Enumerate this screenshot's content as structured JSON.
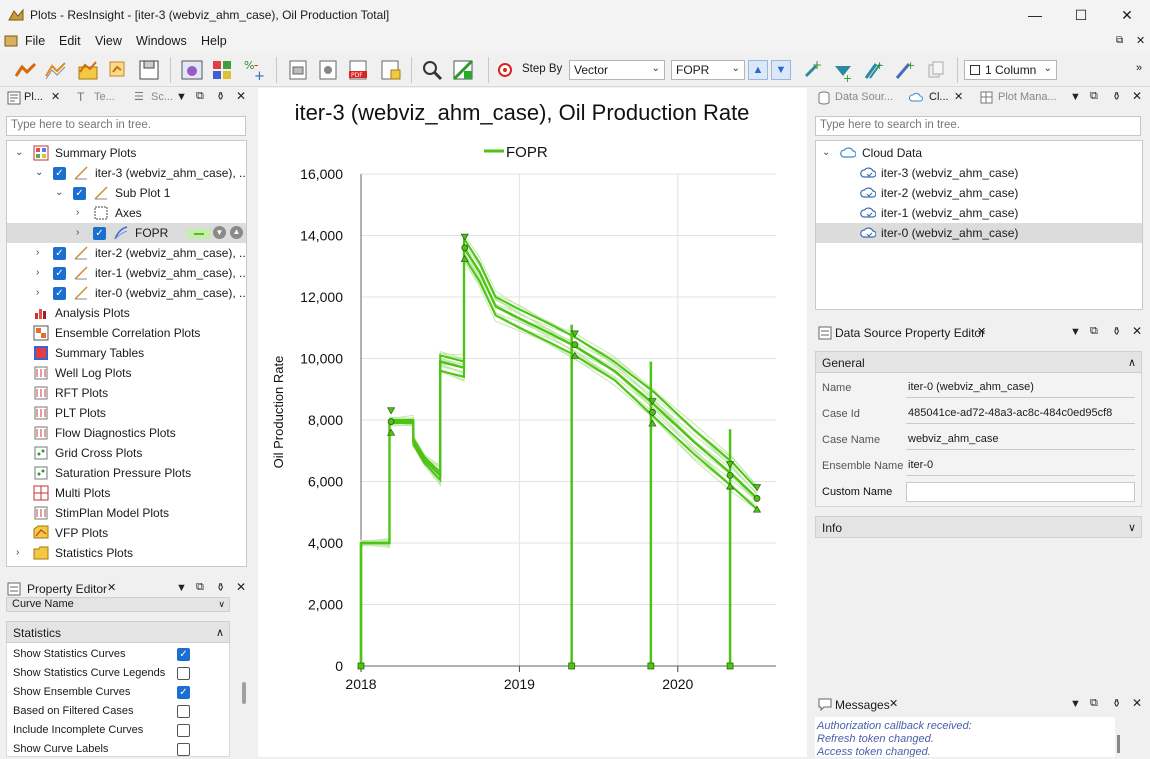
{
  "window": {
    "title": "Plots - ResInsight - [iter-3 (webviz_ahm_case), Oil Production Total]"
  },
  "menu": [
    "File",
    "Edit",
    "View",
    "Windows",
    "Help"
  ],
  "toolbar": {
    "step_by_label": "Step By",
    "step_by_value": "Vector",
    "vector_value": "FOPR",
    "columns_value": "1 Column"
  },
  "left_dock": {
    "tabs": [
      "Pl...",
      "Te...",
      "Sc..."
    ],
    "search_placeholder": "Type here to search in tree."
  },
  "tree": [
    {
      "label": "Summary Plots",
      "indent": 0,
      "exp": "open",
      "cb": "none",
      "icon": "summary"
    },
    {
      "label": "iter-3 (webviz_ahm_case), ...",
      "indent": 1,
      "exp": "open",
      "cb": "on",
      "icon": "plot"
    },
    {
      "label": "Sub Plot 1",
      "indent": 2,
      "exp": "open",
      "cb": "on",
      "icon": "plot"
    },
    {
      "label": "Axes",
      "indent": 3,
      "exp": "closed",
      "cb": "none",
      "icon": "axes"
    },
    {
      "label": "FOPR",
      "indent": 3,
      "exp": "closed",
      "cb": "on",
      "icon": "curve",
      "selected": true
    },
    {
      "label": "iter-2 (webviz_ahm_case), ...",
      "indent": 1,
      "exp": "closed",
      "cb": "on",
      "icon": "plot"
    },
    {
      "label": "iter-1 (webviz_ahm_case), ...",
      "indent": 1,
      "exp": "closed",
      "cb": "on",
      "icon": "plot"
    },
    {
      "label": "iter-0 (webviz_ahm_case), ...",
      "indent": 1,
      "exp": "closed",
      "cb": "on",
      "icon": "plot"
    },
    {
      "label": "Analysis Plots",
      "indent": 0,
      "exp": "none",
      "cb": "none",
      "icon": "analysis"
    },
    {
      "label": "Ensemble Correlation Plots",
      "indent": 0,
      "exp": "none",
      "cb": "none",
      "icon": "corr"
    },
    {
      "label": "Summary Tables",
      "indent": 0,
      "exp": "none",
      "cb": "none",
      "icon": "table"
    },
    {
      "label": "Well Log Plots",
      "indent": 0,
      "exp": "none",
      "cb": "none",
      "icon": "well"
    },
    {
      "label": "RFT Plots",
      "indent": 0,
      "exp": "none",
      "cb": "none",
      "icon": "well"
    },
    {
      "label": "PLT Plots",
      "indent": 0,
      "exp": "none",
      "cb": "none",
      "icon": "well"
    },
    {
      "label": "Flow Diagnostics Plots",
      "indent": 0,
      "exp": "none",
      "cb": "none",
      "icon": "well"
    },
    {
      "label": "Grid Cross Plots",
      "indent": 0,
      "exp": "none",
      "cb": "none",
      "icon": "cross"
    },
    {
      "label": "Saturation Pressure Plots",
      "indent": 0,
      "exp": "none",
      "cb": "none",
      "icon": "cross"
    },
    {
      "label": "Multi Plots",
      "indent": 0,
      "exp": "none",
      "cb": "none",
      "icon": "multi"
    },
    {
      "label": "StimPlan Model Plots",
      "indent": 0,
      "exp": "none",
      "cb": "none",
      "icon": "well"
    },
    {
      "label": "VFP Plots",
      "indent": 0,
      "exp": "none",
      "cb": "none",
      "icon": "vfp"
    },
    {
      "label": "Statistics Plots",
      "indent": 0,
      "exp": "closed",
      "cb": "none",
      "icon": "folder"
    }
  ],
  "property_editor": {
    "title": "Property Editor",
    "curve_name_label": "Curve Name",
    "group_label": "Statistics",
    "rows": [
      {
        "label": "Show Statistics Curves",
        "checked": true
      },
      {
        "label": "Show Statistics Curve Legends",
        "checked": false
      },
      {
        "label": "Show Ensemble Curves",
        "checked": true
      },
      {
        "label": "Based on Filtered Cases",
        "checked": false
      },
      {
        "label": "Include Incomplete Curves",
        "checked": false
      },
      {
        "label": "Show Curve Labels",
        "checked": false
      }
    ]
  },
  "right_dock": {
    "tabs": [
      "Data Sour...",
      "Cl...",
      "Plot Mana..."
    ],
    "search_placeholder": "Type here to search in tree.",
    "cloud_root": "Cloud Data",
    "cloud_items": [
      "iter-3 (webviz_ahm_case)",
      "iter-2 (webviz_ahm_case)",
      "iter-1 (webviz_ahm_case)",
      "iter-0 (webviz_ahm_case)"
    ]
  },
  "ds_editor": {
    "title": "Data Source Property Editor",
    "general": "General",
    "info": "Info",
    "fields": [
      {
        "label": "Name",
        "value": "iter-0 (webviz_ahm_case)"
      },
      {
        "label": "Case Id",
        "value": "485041ce-ad72-48a3-ac8c-484c0ed95cf8"
      },
      {
        "label": "Case Name",
        "value": "webviz_ahm_case"
      },
      {
        "label": "Ensemble Name",
        "value": "iter-0"
      },
      {
        "label": "Custom Name",
        "value": ""
      }
    ]
  },
  "messages": {
    "title": "Messages",
    "lines": [
      "Authorization callback received:",
      "Refresh token changed.",
      "Access token changed."
    ]
  },
  "chart_data": {
    "type": "line",
    "title": "iter-3 (webviz_ahm_case), Oil Production Rate",
    "ylabel": "Oil Production Rate",
    "xlabel": "",
    "legend": "top",
    "series_name": "FOPR",
    "color": "#4ec316",
    "ylim": [
      0,
      16000
    ],
    "yticks": [
      0,
      2000,
      4000,
      6000,
      8000,
      10000,
      12000,
      14000,
      16000
    ],
    "ytick_labels": [
      "0",
      "2,000",
      "4,000",
      "6,000",
      "8,000",
      "10,000",
      "12,000",
      "14,000",
      "16,000"
    ],
    "xlim": [
      2018.0,
      2020.62
    ],
    "xticks": [
      2018,
      2019,
      2020
    ],
    "xtick_labels": [
      "2018",
      "2019",
      "2020"
    ],
    "grid": true,
    "mean": [
      [
        2018.0,
        0
      ],
      [
        2018.0,
        4000
      ],
      [
        2018.18,
        4000
      ],
      [
        2018.18,
        7950
      ],
      [
        2018.33,
        7950
      ],
      [
        2018.33,
        7300
      ],
      [
        2018.4,
        6700
      ],
      [
        2018.5,
        6200
      ],
      [
        2018.5,
        9900
      ],
      [
        2018.65,
        9700
      ],
      [
        2018.65,
        13600
      ],
      [
        2018.75,
        12800
      ],
      [
        2018.85,
        11700
      ],
      [
        2019.0,
        11300
      ],
      [
        2019.2,
        10800
      ],
      [
        2019.35,
        10400
      ],
      [
        2019.6,
        9600
      ],
      [
        2019.85,
        8500
      ],
      [
        2020.1,
        7300
      ],
      [
        2020.35,
        6200
      ],
      [
        2020.5,
        5450
      ]
    ],
    "p10": [
      [
        2018.0,
        4000
      ],
      [
        2018.18,
        4000
      ],
      [
        2018.18,
        8000
      ],
      [
        2018.33,
        8000
      ],
      [
        2018.33,
        7400
      ],
      [
        2018.4,
        6800
      ],
      [
        2018.5,
        6300
      ],
      [
        2018.5,
        10100
      ],
      [
        2018.65,
        9900
      ],
      [
        2018.65,
        13900
      ],
      [
        2018.75,
        13100
      ],
      [
        2018.85,
        12000
      ],
      [
        2019.0,
        11600
      ],
      [
        2019.2,
        11100
      ],
      [
        2019.35,
        10700
      ],
      [
        2019.6,
        9900
      ],
      [
        2019.85,
        8900
      ],
      [
        2020.1,
        7700
      ],
      [
        2020.35,
        6600
      ],
      [
        2020.5,
        5750
      ]
    ],
    "p90": [
      [
        2018.0,
        4000
      ],
      [
        2018.18,
        4000
      ],
      [
        2018.18,
        7900
      ],
      [
        2018.33,
        7900
      ],
      [
        2018.33,
        7200
      ],
      [
        2018.4,
        6600
      ],
      [
        2018.5,
        6050
      ],
      [
        2018.5,
        9600
      ],
      [
        2018.65,
        9400
      ],
      [
        2018.65,
        13300
      ],
      [
        2018.75,
        12500
      ],
      [
        2018.85,
        11400
      ],
      [
        2019.0,
        11000
      ],
      [
        2019.2,
        10500
      ],
      [
        2019.35,
        10100
      ],
      [
        2019.6,
        9300
      ],
      [
        2019.85,
        8100
      ],
      [
        2020.1,
        6900
      ],
      [
        2020.35,
        5800
      ],
      [
        2020.5,
        5100
      ]
    ],
    "dropouts": [
      2018.0,
      2019.33,
      2019.83,
      2020.33
    ]
  }
}
